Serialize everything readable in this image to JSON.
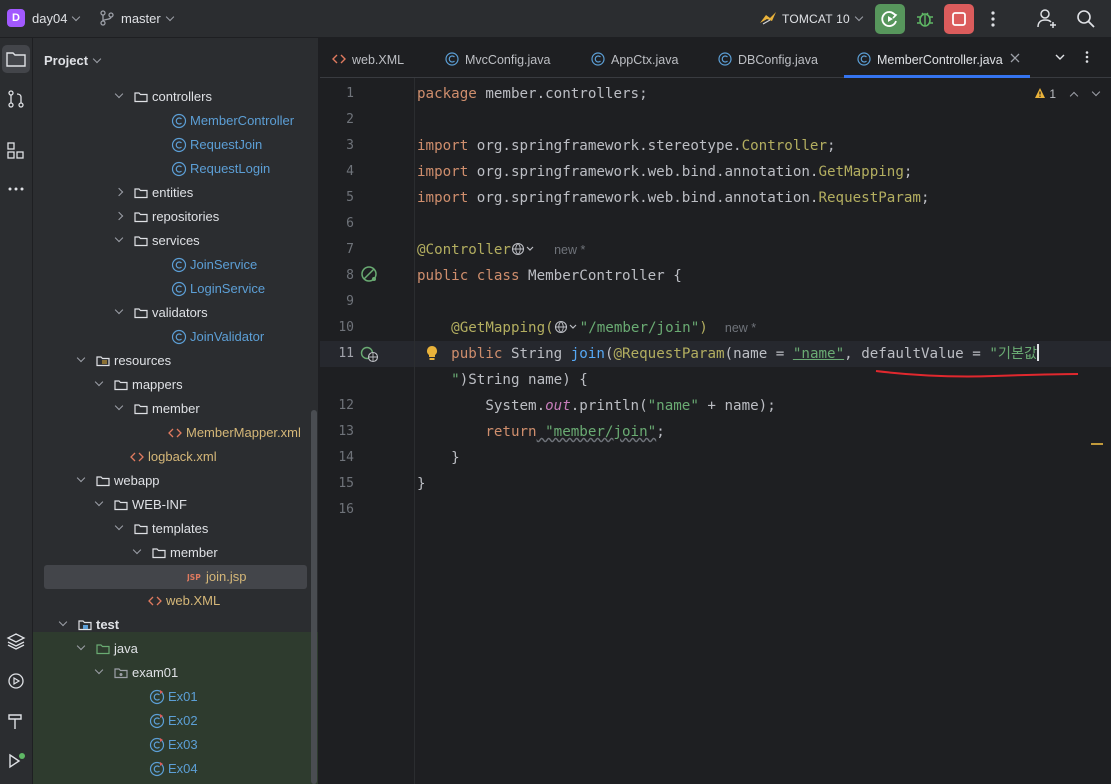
{
  "titlebar": {
    "project_badge": "D",
    "project_name": "day04",
    "branch": "master",
    "run_config": "TOMCAT 10"
  },
  "project_panel": {
    "title": "Project",
    "tree": [
      {
        "label": "controllers",
        "type": "folder",
        "expanded": true
      },
      {
        "label": "MemberController",
        "type": "class"
      },
      {
        "label": "RequestJoin",
        "type": "class"
      },
      {
        "label": "RequestLogin",
        "type": "class"
      },
      {
        "label": "entities",
        "type": "folder",
        "expanded": false
      },
      {
        "label": "repositories",
        "type": "folder",
        "expanded": false
      },
      {
        "label": "services",
        "type": "folder",
        "expanded": true
      },
      {
        "label": "JoinService",
        "type": "class"
      },
      {
        "label": "LoginService",
        "type": "class"
      },
      {
        "label": "validators",
        "type": "folder",
        "expanded": true
      },
      {
        "label": "JoinValidator",
        "type": "class"
      },
      {
        "label": "resources",
        "type": "resfolder",
        "expanded": true
      },
      {
        "label": "mappers",
        "type": "folder",
        "expanded": true
      },
      {
        "label": "member",
        "type": "folder",
        "expanded": true
      },
      {
        "label": "MemberMapper.xml",
        "type": "xml"
      },
      {
        "label": "logback.xml",
        "type": "xml"
      },
      {
        "label": "webapp",
        "type": "folder",
        "expanded": true
      },
      {
        "label": "WEB-INF",
        "type": "folder",
        "expanded": true
      },
      {
        "label": "templates",
        "type": "folder",
        "expanded": true
      },
      {
        "label": "member",
        "type": "folder",
        "expanded": true
      },
      {
        "label": "join.jsp",
        "type": "jsp"
      },
      {
        "label": "web.XML",
        "type": "webxml"
      },
      {
        "label": "test",
        "type": "testroot",
        "expanded": true
      },
      {
        "label": "java",
        "type": "testfolder",
        "expanded": true
      },
      {
        "label": "exam01",
        "type": "package",
        "expanded": true
      },
      {
        "label": "Ex01",
        "type": "testclass"
      },
      {
        "label": "Ex02",
        "type": "testclass"
      },
      {
        "label": "Ex03",
        "type": "testclass"
      },
      {
        "label": "Ex04",
        "type": "testclass"
      }
    ]
  },
  "editor": {
    "tabs": [
      {
        "label": "web.XML",
        "icon": "xml-icon"
      },
      {
        "label": "MvcConfig.java",
        "icon": "class-icon"
      },
      {
        "label": "AppCtx.java",
        "icon": "class-icon"
      },
      {
        "label": "DBConfig.java",
        "icon": "class-icon"
      },
      {
        "label": "MemberController.java",
        "icon": "class-icon",
        "active": true
      }
    ],
    "warning_count": "1",
    "line_numbers": [
      "1",
      "2",
      "3",
      "4",
      "5",
      "6",
      "7",
      "8",
      "9",
      "10",
      "11",
      "",
      "12",
      "13",
      "14",
      "15",
      "16"
    ],
    "lines": {
      "l1_kw": "package",
      "l1_rest": " member.controllers;",
      "l3_kw": "import",
      "l3_pkg": " org.springframework.stereotype.",
      "l3_cls": "Controller",
      "l4_kw": "import",
      "l4_pkg": " org.springframework.web.bind.annotation.",
      "l4_cls": "GetMapping",
      "l5_kw": "import",
      "l5_pkg": " org.springframework.web.bind.annotation.",
      "l5_cls": "RequestParam",
      "l7_ann": "@Controller",
      "l7_hint": "new *",
      "l8_kw": "public class",
      "l8_rest": " MemberController {",
      "l10_ann": "@GetMapping(",
      "l10_str": "\"/member/join\"",
      "l10_close": ")",
      "l10_hint": "new *",
      "l11_kw": "public",
      "l11_type": " String ",
      "l11_fn": "join",
      "l11_paren": "(",
      "l11_ann": "@RequestParam",
      "l11_args": "(name = ",
      "l11_str1": "\"name\"",
      "l11_mid": ", defaultValue = ",
      "l11_str2": "\"기본값",
      "l11b_str": "\"",
      "l11b_rest": ")String name) {",
      "l12_a": "System.",
      "l12_field": "out",
      "l12_b": ".println(",
      "l12_str": "\"name\"",
      "l12_c": " + name);",
      "l13_kw": "return",
      "l13_str": " \"member/join\"",
      "l13_end": ";",
      "l14": "}",
      "l15": "}"
    }
  }
}
